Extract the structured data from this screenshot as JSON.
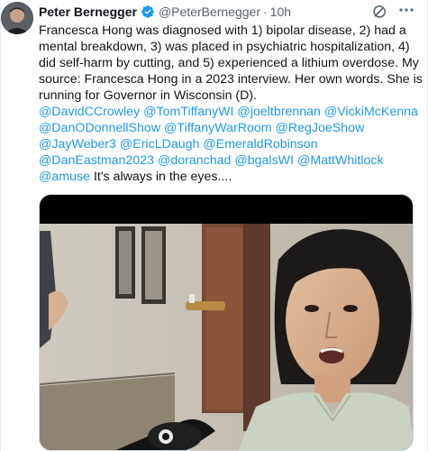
{
  "author": {
    "name": "Peter Bernegger",
    "handle": "@PeterBernegger",
    "separator": "·",
    "time": "10h"
  },
  "icons": {
    "verified": "verified-badge-icon",
    "grok": "grok-icon",
    "more": "more-options-icon"
  },
  "colors": {
    "link": "#1d9bf0",
    "text": "#0f1419",
    "muted": "#536471",
    "verified": "#1d9bf0"
  },
  "tweet": {
    "line1": "Francesca Hong was diagnosed with 1) bipolar disease, 2) had a mental breakdown, 3) was placed in psychiatric hospitalization, 4) did self-harm by cutting, and 5)  experienced a lithium overdose. My source: Francesca Hong in a 2023 interview. Her own words. She is running for Governor in Wisconsin (D).",
    "mentions": [
      "@DavidCCrowley",
      "@TomTiffanyWI",
      "@joeltbrennan",
      "@VickiMcKenna",
      "@DanODonnellShow",
      "@TiffanyWarRoom",
      "@RegJoeShow",
      "@JayWeber3",
      "@EricLDaugh",
      "@EmeraldRobinson",
      "@DanEastman2023",
      "@doranchad",
      "@bgalsWI",
      "@MattWhitlock",
      "@amuse"
    ],
    "closing": " It's always in the eyes...."
  }
}
